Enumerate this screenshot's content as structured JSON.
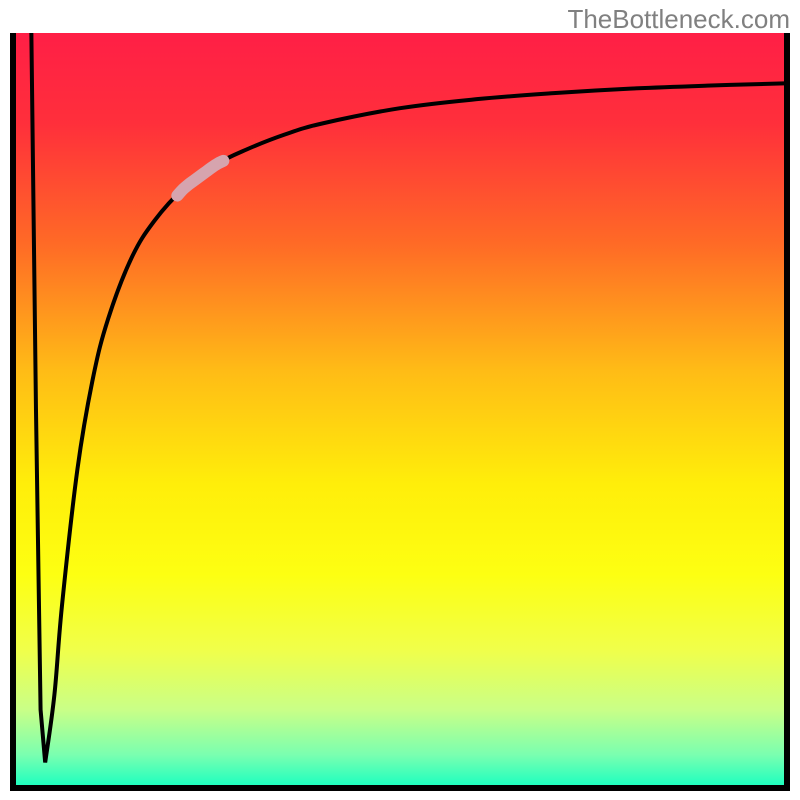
{
  "watermark": "TheBottleneck.com",
  "chart_data": {
    "type": "line",
    "title": "",
    "xlabel": "",
    "ylabel": "",
    "xlim": [
      0,
      100
    ],
    "ylim": [
      0,
      100
    ],
    "series": [
      {
        "name": "left-spike",
        "x": [
          2.0,
          2.6,
          3.2,
          3.8
        ],
        "values": [
          100,
          50,
          10,
          3
        ]
      },
      {
        "name": "main-curve",
        "x": [
          3.8,
          5,
          6,
          8,
          10,
          12,
          15,
          18,
          22,
          26,
          30,
          35,
          40,
          50,
          60,
          70,
          80,
          90,
          100
        ],
        "values": [
          3,
          12,
          24,
          42,
          54,
          62,
          70,
          75,
          79.5,
          82.5,
          84.5,
          86.5,
          88,
          90,
          91.2,
          92,
          92.6,
          93,
          93.3
        ]
      }
    ],
    "highlight_segment": {
      "series": "main-curve",
      "x_range": [
        21,
        27
      ],
      "value_range": [
        78.5,
        83
      ]
    },
    "background_gradient": {
      "stops": [
        {
          "pos": 0.0,
          "color": "#ff1f46"
        },
        {
          "pos": 0.12,
          "color": "#ff2f3b"
        },
        {
          "pos": 0.28,
          "color": "#ff6a26"
        },
        {
          "pos": 0.45,
          "color": "#ffbc16"
        },
        {
          "pos": 0.6,
          "color": "#ffee0a"
        },
        {
          "pos": 0.72,
          "color": "#fdff12"
        },
        {
          "pos": 0.82,
          "color": "#f0ff4a"
        },
        {
          "pos": 0.9,
          "color": "#c9ff87"
        },
        {
          "pos": 0.96,
          "color": "#7affb0"
        },
        {
          "pos": 1.0,
          "color": "#1fffbf"
        }
      ]
    }
  }
}
